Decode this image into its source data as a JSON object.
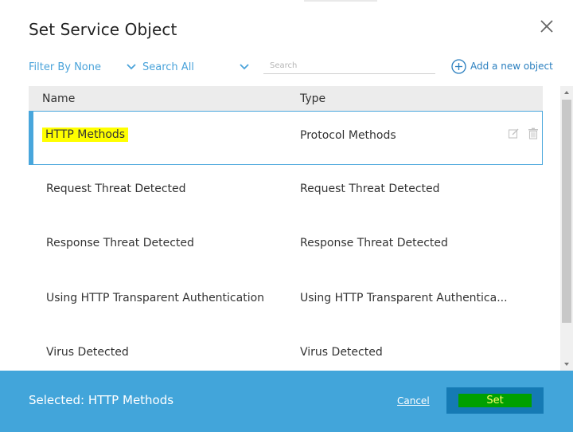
{
  "dialog": {
    "title": "Set Service Object"
  },
  "toolbar": {
    "filter_label": "Filter By None",
    "search_scope_label": "Search All",
    "search_placeholder": "Search",
    "search_value": "",
    "add_object_label": "Add a new object"
  },
  "table": {
    "columns": [
      "Name",
      "Type"
    ],
    "rows": [
      {
        "name": "HTTP Methods",
        "type": "Protocol Methods",
        "selected": true
      },
      {
        "name": "Request Threat Detected",
        "type": "Request Threat Detected"
      },
      {
        "name": "Response Threat Detected",
        "type": "Response Threat Detected"
      },
      {
        "name": "Using HTTP Transparent Authentication",
        "type": "Using HTTP Transparent Authentica..."
      },
      {
        "name": "Virus Detected",
        "type": "Virus Detected"
      }
    ]
  },
  "footer": {
    "selected_text": "Selected: HTTP Methods",
    "cancel_label": "Cancel",
    "set_label": "Set"
  },
  "icons": {
    "close": "close-icon",
    "chevron": "chevron-down-icon",
    "add": "plus-circle-icon",
    "edit": "edit-icon",
    "delete": "trash-icon"
  },
  "colors": {
    "accent": "#42a5da",
    "link": "#4aa3da",
    "set_button": "#157ab4",
    "highlight": "#ffff00"
  }
}
